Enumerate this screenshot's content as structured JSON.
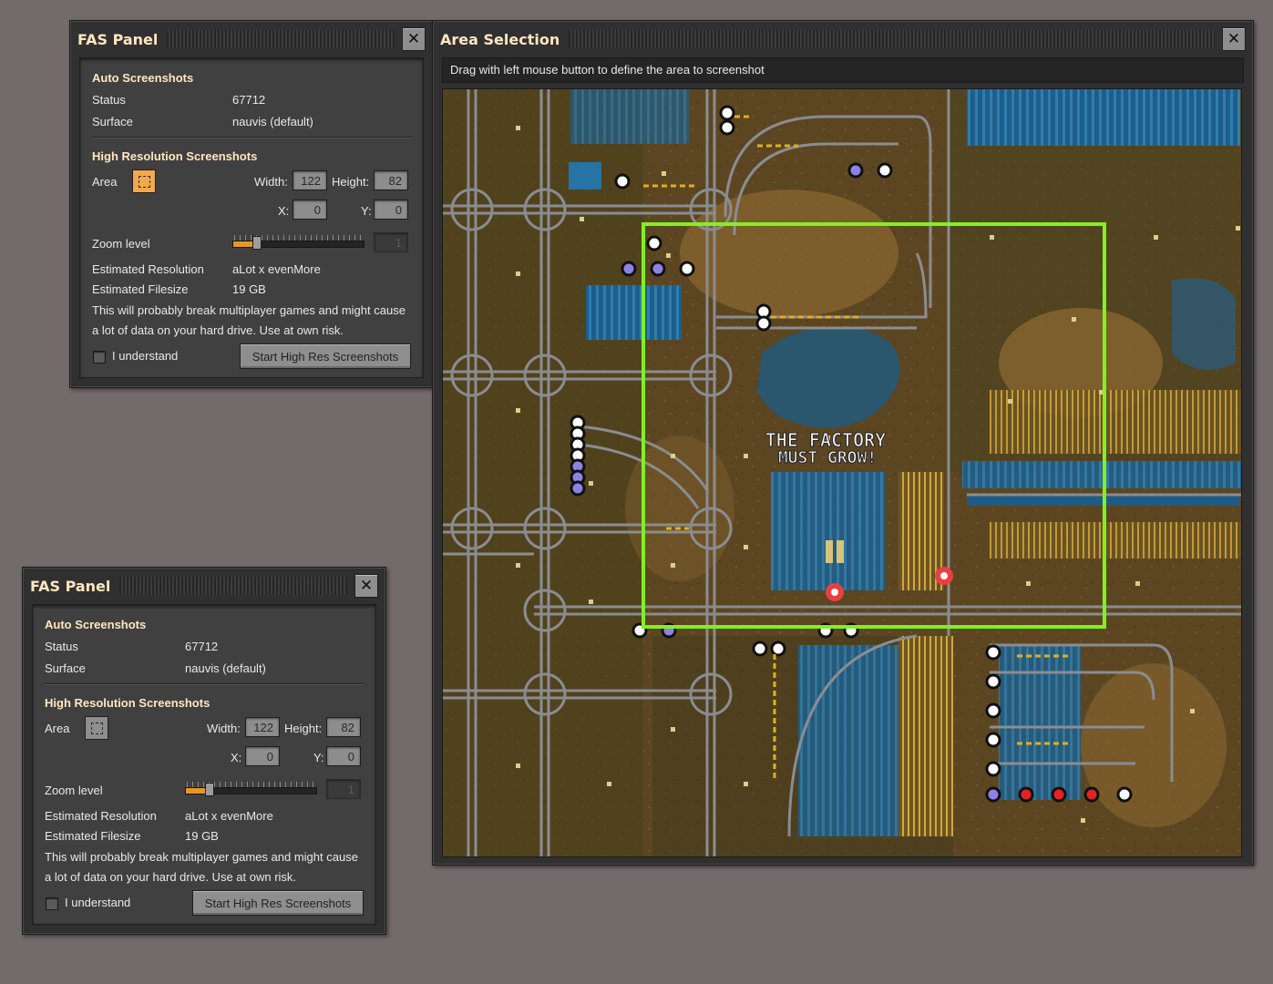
{
  "fas_panel": {
    "title": "FAS Panel",
    "auto_header": "Auto Screenshots",
    "status_label": "Status",
    "status_value": "67712",
    "surface_label": "Surface",
    "surface_value": "nauvis (default)",
    "hires_header": "High Resolution Screenshots",
    "area_label": "Area",
    "width_label": "Width:",
    "width_value": "122",
    "height_label": "Height:",
    "height_value": "82",
    "x_label": "X:",
    "x_value": "0",
    "y_label": "Y:",
    "y_value": "0",
    "zoom_label": "Zoom level",
    "zoom_value": "1",
    "zoom_fraction": 0.16,
    "est_res_label": "Estimated Resolution",
    "est_res_value": "aLot x evenMore",
    "est_size_label": "Estimated Filesize",
    "est_size_value": "19 GB",
    "warning_line1": "This will probably break multiplayer games and might cause",
    "warning_line2": "a lot of data on your hard drive. Use at own risk.",
    "understand_label": "I understand",
    "start_button": "Start High Res Screenshots"
  },
  "area_selection": {
    "title": "Area Selection",
    "instruction": "Drag with left mouse button to define the area to screenshot",
    "map_banner_line1": "THE FACTORY",
    "map_banner_line2": "MUST GROW!",
    "selection_color": "#7ff21f"
  },
  "colors": {
    "area_button_active": "#f2a94a",
    "area_button_inactive": "#8e8e8e",
    "header_text": "#ffe6c0"
  }
}
